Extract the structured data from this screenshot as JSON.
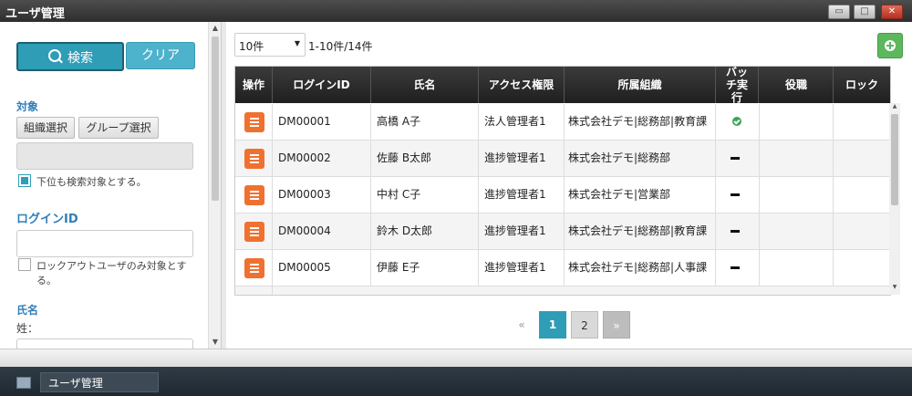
{
  "window": {
    "title": "ユーザ管理",
    "controls": [
      "minimize-icon",
      "maximize-icon",
      "close-icon"
    ]
  },
  "sidebar": {
    "search_label": "検索",
    "clear_label": "クリア",
    "target_heading": "対象",
    "org_select_label": "組織選択",
    "group_select_label": "グループ選択",
    "include_lower_label": "下位も検索対象とする。",
    "include_lower_checked": true,
    "login_id_heading": "ログインID",
    "login_id_value": "",
    "lockout_only_label_1": "ロックアウトユーザのみ対象とす",
    "lockout_only_label_2": "る。",
    "lockout_only_checked": false,
    "name_heading": "氏名",
    "surname_label": "姓："
  },
  "toolbar": {
    "per_page": "10件",
    "range_text": "1-10件/14件",
    "add_icon": "plus-circle-icon"
  },
  "table": {
    "columns": [
      "操作",
      "ログインID",
      "氏名",
      "アクセス権限",
      "所属組織",
      "バッチ実行",
      "役職",
      "ロック"
    ],
    "rows": [
      {
        "login_id": "DM00001",
        "name": "高橋 A子",
        "access": "法人管理者1",
        "org": "株式会社デモ|総務部|教育課",
        "batch": "check",
        "position": "",
        "lock": ""
      },
      {
        "login_id": "DM00002",
        "name": "佐藤 B太郎",
        "access": "進捗管理者1",
        "org": "株式会社デモ|総務部",
        "batch": "dash",
        "position": "",
        "lock": ""
      },
      {
        "login_id": "DM00003",
        "name": "中村 C子",
        "access": "進捗管理者1",
        "org": "株式会社デモ|営業部",
        "batch": "dash",
        "position": "",
        "lock": ""
      },
      {
        "login_id": "DM00004",
        "name": "鈴木 D太郎",
        "access": "進捗管理者1",
        "org": "株式会社デモ|総務部|教育課",
        "batch": "dash",
        "position": "",
        "lock": ""
      },
      {
        "login_id": "DM00005",
        "name": "伊藤 E子",
        "access": "進捗管理者1",
        "org": "株式会社デモ|総務部|人事課",
        "batch": "dash",
        "position": "",
        "lock": ""
      }
    ]
  },
  "pagination": {
    "prev": "«",
    "pages": [
      "1",
      "2"
    ],
    "current": "1",
    "next": "»"
  },
  "taskbar": {
    "tab_label": "ユーザ管理"
  }
}
